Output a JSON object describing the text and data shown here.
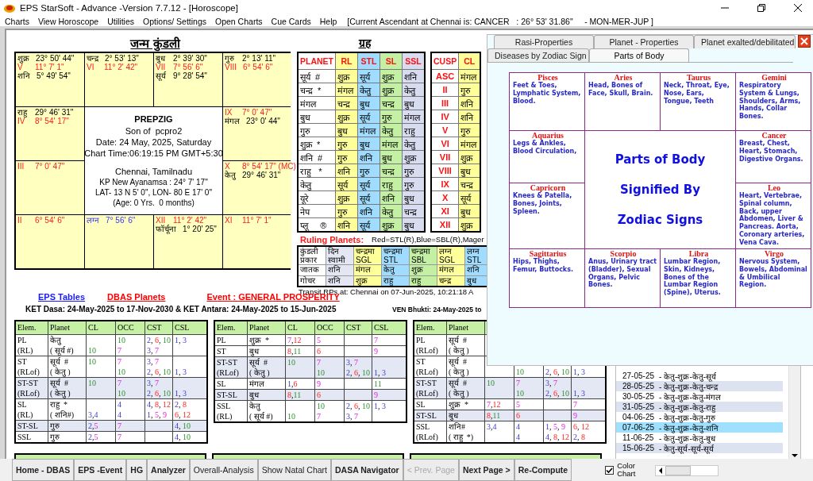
{
  "window": {
    "title": "EPS StarSoft - Advance -Version 7.7.12 - [Horoscope]"
  },
  "menu": [
    "Charts",
    "View Horoscope",
    "Utilities",
    "Options/ Settings",
    "Open Charts",
    "Cue Cards",
    "Help"
  ],
  "ascendant_info": "[Current Ascendant at Chennai is: CANCER   : 26° 53' 31.86\"     - MON-MER-JUP ]",
  "birth_chart": {
    "title": "जन्म कुंडली",
    "houses": [
      {
        "entries": [
          {
            "kind": "planet",
            "name": "शुक्र",
            "value": "23° 50' 44\""
          },
          {
            "kind": "cusp",
            "name": "V",
            "value": "11° 7' 1\""
          },
          {
            "kind": "planet",
            "name": "शनि",
            "value": "5° 49' 54\""
          }
        ]
      },
      {
        "entries": [
          {
            "kind": "planet",
            "name": "चन्द्र",
            "value": "2° 53' 13\""
          },
          {
            "kind": "cusp",
            "name": "VI",
            "value": "11° 2' 42\""
          }
        ]
      },
      {
        "entries": [
          {
            "kind": "planet",
            "name": "बुध",
            "value": "2° 39' 30\""
          },
          {
            "kind": "cusp",
            "name": "VII",
            "value": "7° 56' 6\""
          },
          {
            "kind": "planet",
            "name": "सूर्य",
            "value": "9° 28' 54\""
          }
        ]
      },
      {
        "entries": [
          {
            "kind": "planet",
            "name": "गुरु",
            "value": "2° 13' 11\""
          },
          {
            "kind": "cusp",
            "name": "VIII",
            "value": "6° 54' 6\""
          }
        ]
      },
      {
        "entries": [
          {
            "kind": "planet",
            "name": "राहु",
            "value": "29° 46' 31\""
          },
          {
            "kind": "cusp",
            "name": "IV",
            "value": "8° 54' 17\""
          }
        ]
      },
      {
        "entries": [
          {
            "kind": "cusp",
            "name": "IX",
            "value": "7° 0' 47\""
          },
          {
            "kind": "planet",
            "name": "मंगल",
            "value": "23° 0' 44\""
          }
        ]
      },
      {
        "entries": [
          {
            "kind": "cusp",
            "name": "III",
            "value": "7° 0' 47\""
          }
        ]
      },
      {
        "entries": [
          {
            "kind": "cusp",
            "name": "X",
            "value": "8° 54' 17\" (MC)"
          },
          {
            "kind": "planet",
            "name": "केतु",
            "value": "29° 46' 31\""
          }
        ]
      },
      {
        "entries": [
          {
            "kind": "cusp",
            "name": "II",
            "value": "6° 54' 6\""
          }
        ]
      },
      {
        "entries": [
          {
            "kind": "lagna",
            "name": "लग्न",
            "value": "7° 56' 6\""
          }
        ]
      },
      {
        "entries": [
          {
            "kind": "cusp",
            "name": "XII",
            "value": "11° 2' 42\""
          },
          {
            "kind": "planet",
            "name": "फॉर्चूना",
            "value": "1° 20' 25\""
          }
        ]
      },
      {
        "entries": [
          {
            "kind": "cusp",
            "name": "XI",
            "value": "11° 7' 1\""
          }
        ]
      }
    ],
    "center": {
      "name": "PREPZIG",
      "lines": [
        "Son of  pcpro2",
        "Date: 24 May, 2025, Saturday",
        "Chart Time:06:19:15 PM GMT+5:30"
      ],
      "place_lines": [
        "Chennai, Tamilnadu",
        "KP New Ayanamsa : 24° 7' 17\"",
        "LAT- 13 N 5' 0\", LON- 80 E 17' 0\"",
        "(Age: 0 Yrs.  0 months)"
      ]
    }
  },
  "planets_table": {
    "title": "ग्रह",
    "columns": [
      "PLANET",
      "RL",
      "STL",
      "SL",
      "SSL"
    ],
    "rows": [
      [
        "सूर्य  #",
        "शुक्र",
        "सूर्य",
        "शुक्र",
        "शनि"
      ],
      [
        "चन्द्र  *",
        "मंगल",
        "केतु",
        "शुक्र",
        "केतु"
      ],
      [
        "मंगल",
        "चन्द्र",
        "बुध",
        "चन्द्र",
        "बुध"
      ],
      [
        "बुध",
        "शुक्र",
        "सूर्य",
        "गुरु",
        "मंगल"
      ],
      [
        "गुरु",
        "बुध",
        "मंगल",
        "केतु",
        "राहु"
      ],
      [
        "शुक्र  *",
        "गुरु",
        "बुध",
        "मंगल",
        "केतु"
      ],
      [
        "शनि  #",
        "गुरु",
        "शनि",
        "बुध",
        "शुक्र"
      ],
      [
        "राहु   *",
        "शनि",
        "गुरु",
        "चन्द्र",
        "गुरु"
      ],
      [
        "केतु",
        "सूर्य",
        "सूर्य",
        "राहु",
        "गुरु"
      ],
      [
        "यूरे",
        "शुक्र",
        "सूर्य",
        "शनि",
        "बुध"
      ],
      [
        "नेप",
        "गुरु",
        "शनि",
        "केतु",
        "चन्द्र"
      ],
      [
        "प्लू     ®",
        "शनि",
        "सूर्य",
        "शुक्र",
        "बुध"
      ]
    ]
  },
  "cusp_table": {
    "columns": [
      "CUSP",
      "CL"
    ],
    "rows": [
      [
        "ASC",
        "मंगल"
      ],
      [
        "II",
        "गुरु"
      ],
      [
        "III",
        "शनि"
      ],
      [
        "IV",
        "शनि"
      ],
      [
        "V",
        "गुरु"
      ],
      [
        "VI",
        "मंगल"
      ],
      [
        "VII",
        "शुक्र"
      ],
      [
        "VIII",
        "बुध"
      ],
      [
        "IX",
        "चन्द्र"
      ],
      [
        "X",
        "सूर्य"
      ],
      [
        "XI",
        "बुध"
      ],
      [
        "XII",
        "शुक्र"
      ]
    ]
  },
  "ruling_planets": {
    "title": "Ruling Planets:",
    "legend": "Red=STL(R),Blue=SBL(R),Mager",
    "columns": [
      "कुंडली प्रकार",
      "दिन स्वामी",
      "चन्द्रमा SGL",
      "चन्द्रमा STL",
      "चन्द्रमा SBL",
      "लग्न SGL",
      "लग्न STL"
    ],
    "rows": [
      [
        "जातक",
        "शनि",
        "मंगल",
        "केतु",
        "शुक्र",
        "मंगल",
        "शनि"
      ],
      [
        "गोचर",
        "शनि",
        "शुक्र",
        "राहु",
        "राहु",
        "चन्द्र",
        "बुध"
      ]
    ],
    "transit_note": "Transit RPs at: Chennai on 07-Jun-2025, 10:21:18 A"
  },
  "links": [
    {
      "label": "EPS Tables",
      "color": "#1a1aff"
    },
    {
      "label": "DBAS Planets",
      "color": "#ff0000"
    },
    {
      "label": "Event : GENERAL PROSPERITY",
      "color": "#ff0000"
    }
  ],
  "dasa_headings": [
    "KET Dasa: 24-May-2025 to 17-Nov-2030 & KET Antara: 24-May-2025 to 15-Jun-2025",
    "VEN Bhukti: 24-May-2025 to"
  ],
  "dasa_tables": [
    {
      "columns": [
        "Elem.",
        "Planet",
        "CL",
        "OCC",
        "CST",
        "CSL"
      ],
      "groups": [
        {
          "shaded": false,
          "lines": [
            {
              "elem": "PL",
              "planet": "केतु",
              "occ": "10",
              "cst": "2, 6, 10",
              "csl": "1, 3"
            },
            {
              "elem": "(RL)",
              "planet": "( सूर्य #)",
              "cl": "10",
              "occ": "7",
              "cst": "3, 7"
            }
          ]
        },
        {
          "shaded": false,
          "lines": [
            {
              "elem": "ST",
              "planet": "सूर्य  #",
              "cl": "10",
              "occ": "7",
              "cst": "3, 7"
            },
            {
              "elem": "(RLof)",
              "planet": "( केतु )",
              "occ": "10",
              "cst": "2, 6, 10",
              "csl": "1, 3"
            }
          ]
        },
        {
          "shaded": true,
          "lines": [
            {
              "elem": "ST-ST",
              "planet": "सूर्य  #",
              "cl": "10",
              "occ": "7",
              "cst": "3, 7"
            },
            {
              "elem": "(RLof)",
              "planet": "( केतु )",
              "occ": "10",
              "cst": "2, 6, 10",
              "csl": "1, 3"
            }
          ]
        },
        {
          "shaded": false,
          "lines": [
            {
              "elem": "SL",
              "planet": "राहु  *",
              "occ": "4",
              "cst": "4, 8, 12",
              "csl": "2, 8"
            },
            {
              "elem": "(RL)",
              "planet": "( शनि#)",
              "cl": "3,4",
              "occ": "4",
              "cst": "1, 5, 9",
              "csl": "6, 12"
            }
          ]
        },
        {
          "shaded": true,
          "lines": [
            {
              "elem": "ST-SL",
              "planet": "गुरु",
              "cl": "2,5",
              "occ": "7",
              "csl": "4, 10"
            }
          ]
        },
        {
          "shaded": false,
          "lines": [
            {
              "elem": "SSL",
              "planet": "गुरु",
              "cl": "2,5",
              "occ": "7",
              "csl": "4, 10"
            }
          ]
        }
      ]
    },
    {
      "columns": [
        "Elem.",
        "Planet",
        "CL",
        "OCC",
        "CST",
        "CSL"
      ],
      "groups": [
        {
          "shaded": false,
          "lines": [
            {
              "elem": "PL",
              "planet": "शुक्र  *",
              "cl": "7,12",
              "occ": "5",
              "csl": "7"
            }
          ]
        },
        {
          "shaded": false,
          "lines": [
            {
              "elem": "ST",
              "planet": "बुध",
              "cl": "8,11",
              "occ": "6",
              "csl": "9"
            }
          ]
        },
        {
          "shaded": true,
          "lines": [
            {
              "elem": "ST-ST",
              "planet": "सूर्य  #",
              "cl": "10",
              "occ": "7",
              "cst": "3, 7"
            },
            {
              "elem": "(RLof)",
              "planet": "( केतु )",
              "occ": "10",
              "cst": "2, 6, 10",
              "csl": "1, 3"
            }
          ]
        },
        {
          "shaded": false,
          "lines": [
            {
              "elem": "SL",
              "planet": "मंगल",
              "cl": "1,6",
              "occ": "9",
              "csl": "11"
            }
          ]
        },
        {
          "shaded": true,
          "lines": [
            {
              "elem": "ST-SL",
              "planet": "बुध",
              "cl": "8,11",
              "occ": "6",
              "csl": "9"
            }
          ]
        },
        {
          "shaded": false,
          "lines": [
            {
              "elem": "SSL",
              "planet": "केतु",
              "occ": "10",
              "cst": "2, 6, 10",
              "csl": "1, 3"
            },
            {
              "elem": "(RL)",
              "planet": "( सूर्य #)",
              "cl": "10",
              "occ": "7",
              "cst": "3, 7"
            }
          ]
        }
      ]
    },
    {
      "columns": [
        "Elem.",
        "Planet"
      ],
      "groups": [
        {
          "shaded": false,
          "lines": [
            {
              "elem": "PL",
              "planet": "सूर्य  #"
            },
            {
              "elem": "(RLof)",
              "planet": "( केतु )"
            }
          ]
        },
        {
          "shaded": false,
          "lines": [
            {
              "elem": "ST",
              "planet": "सूर्य  #"
            },
            {
              "elem": "(RLof)",
              "planet": "( केतु )",
              "occ": "10",
              "cst": "2, 6, 10",
              "csl": "1, 3"
            }
          ]
        },
        {
          "shaded": true,
          "lines": [
            {
              "elem": "ST-ST",
              "planet": "सूर्य  #",
              "cl": "10",
              "occ": "7",
              "cst": "3, 7"
            },
            {
              "elem": "(RLof)",
              "planet": "( केतु )",
              "occ": "10",
              "cst": "2, 6, 10",
              "csl": "1, 3"
            }
          ]
        },
        {
          "shaded": false,
          "lines": [
            {
              "elem": "SL",
              "planet": "शुक्र  *",
              "cl": "7,12",
              "occ": "5",
              "csl": "7"
            }
          ]
        },
        {
          "shaded": true,
          "lines": [
            {
              "elem": "ST-SL",
              "planet": "बुध",
              "cl": "8,11",
              "occ": "6",
              "csl": "9"
            }
          ]
        },
        {
          "shaded": false,
          "lines": [
            {
              "elem": "SSL",
              "planet": "शनि#",
              "cl": "3,4",
              "occ": "4",
              "cst": "1, 5, 9",
              "csl": "6, 12"
            },
            {
              "elem": "(RLof)",
              "planet": "( राहु  *)",
              "occ": "4",
              "cst": "4, 8, 12",
              "csl": "2, 8"
            }
          ]
        }
      ]
    }
  ],
  "period_list": [
    {
      "date": "27-05-25",
      "sequence": "- केतु-शुक्र-केतु-सूर्य",
      "selected": false
    },
    {
      "date": "28-05-25",
      "sequence": "- केतु-शुक्र-केतु-चन्द्र",
      "selected": false
    },
    {
      "date": "30-05-25",
      "sequence": "- केतु-शुक्र-केतु-मंगल",
      "selected": false
    },
    {
      "date": "31-05-25",
      "sequence": "- केतु-शुक्र-केतु-राहु",
      "selected": false
    },
    {
      "date": "04-06-25",
      "sequence": "- केतु-शुक्र-केतु-गुरु",
      "selected": false
    },
    {
      "date": "07-06-25",
      "sequence": "- केतु-शुक्र-केतु-शनि",
      "selected": true
    },
    {
      "date": "11-06-25",
      "sequence": "- केतु-शुक्र-केतु-बुध",
      "selected": false
    },
    {
      "date": "15-06-25",
      "sequence": "- केतु-सूर्य-सूर्य-सूर्य",
      "selected": false
    }
  ],
  "popup": {
    "tab_rows": [
      [
        {
          "label": "Rasi-Properties",
          "selected": false
        },
        {
          "label": "Planet - Properties",
          "selected": false
        },
        {
          "label": "Planet exalted/debilitated",
          "selected": false
        }
      ],
      [
        {
          "label": "Diseases by Zodiac Sign",
          "selected": false
        },
        {
          "label": "Parts of Body",
          "selected": true
        }
      ]
    ],
    "signs": [
      {
        "name": "Pisces",
        "parts": "Feet & Toes, Lymphatic System, Blood."
      },
      {
        "name": "Aries",
        "parts": "Head, Bones of Face, Skull, Brain."
      },
      {
        "name": "Taurus",
        "parts": "Neck, Throat, Eye, Nose, Ears, Tongue, Teeth"
      },
      {
        "name": "Gemini",
        "parts": "Respiratory System & Lungs, Shoulders, Arms, Hands, Collar Bones."
      },
      {
        "name": "Aquarius",
        "parts": "Legs & Ankles, Blood Circulation,"
      },
      {
        "name": "Cancer",
        "parts": "Breast, Chest, Heart, Stomach, Digestive Organs."
      },
      {
        "name": "Capricorn",
        "parts": "Knees & Patella, Bones, Joints, Spleen."
      },
      {
        "name": "Leo",
        "parts": "Heart, Vertebrae, Spinal column, Back, upper Abdomen, Liver & Pancreas. Aorta, Coronary arteries, Vena Cava."
      },
      {
        "name": "Sagittarius",
        "parts": "Hips, Thighs, Femur, Buttocks."
      },
      {
        "name": "Scorpio",
        "parts": "Anus, Urinary tract (Bladder), Sexual Organs, Pelvic Bones."
      },
      {
        "name": "Libra",
        "parts": "Lumbar Region, Skin, Kidneys, Bones of the Lumbar Region (Spine), Uterus."
      },
      {
        "name": "Virgo",
        "parts": "Nervous System, Bowels, Abdominal & Umbilical Region."
      }
    ],
    "center_lines": [
      "Parts of Body",
      "Signified By",
      "Zodiac Signs"
    ]
  },
  "buttons": [
    {
      "label": "Home - DBAS",
      "kind": "bold",
      "disabled": false
    },
    {
      "label": "EPS -Event",
      "kind": "bold",
      "disabled": false
    },
    {
      "label": "HG",
      "kind": "bold",
      "disabled": false
    },
    {
      "label": "Analyzer",
      "kind": "bold",
      "disabled": false
    },
    {
      "label": "Overall-Analysis",
      "kind": "plain",
      "disabled": false
    },
    {
      "label": "Show Natal Chart",
      "kind": "plain",
      "disabled": false
    },
    {
      "label": "DASA Navigator",
      "kind": "bold",
      "disabled": false
    },
    {
      "label": "< Prev. Page",
      "kind": "plain",
      "disabled": true
    },
    {
      "label": "Next Page >",
      "kind": "bold",
      "disabled": false
    },
    {
      "label": "Re-Compute",
      "kind": "bold",
      "disabled": false
    }
  ],
  "color_chart": {
    "label": "Color Chart",
    "checked": true
  }
}
